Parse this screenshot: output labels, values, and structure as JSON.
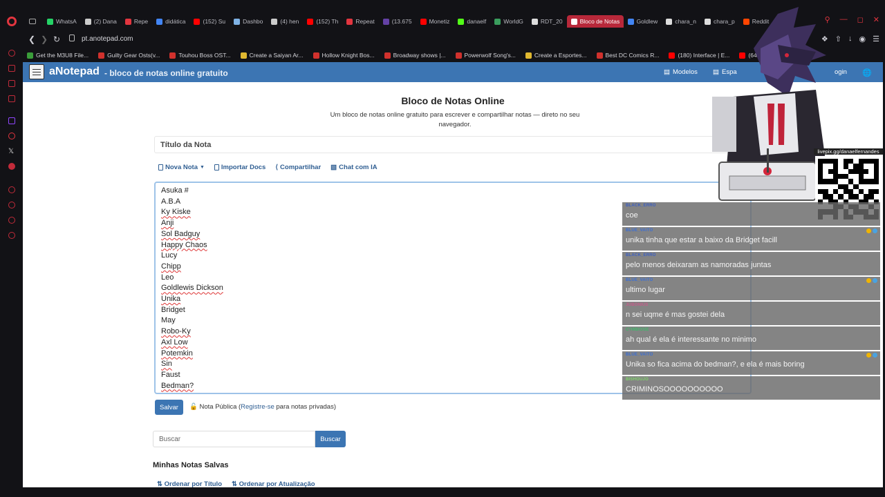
{
  "browser": {
    "tabs": [
      {
        "label": "WhatsA",
        "color": "#25d366"
      },
      {
        "label": "(2) Dana",
        "color": "#cccccc"
      },
      {
        "label": "Repe",
        "color": "#e2353f"
      },
      {
        "label": "didática",
        "color": "#4285f4"
      },
      {
        "label": "(152) Su",
        "color": "#ff0000"
      },
      {
        "label": "Dashbo",
        "color": "#7fb2e5"
      },
      {
        "label": "(4) hen",
        "color": "#cccccc"
      },
      {
        "label": "(152) Th",
        "color": "#ff0000"
      },
      {
        "label": "Repeat",
        "color": "#e2353f"
      },
      {
        "label": "(13.675",
        "color": "#6441a5"
      },
      {
        "label": "Monetiz",
        "color": "#ff0000"
      },
      {
        "label": "danaelf",
        "color": "#53fc18"
      },
      {
        "label": "WorldG",
        "color": "#3a9d5d"
      },
      {
        "label": "RDT_20",
        "color": "#dddddd"
      },
      {
        "label": "Bloco de Notas",
        "color": "#ffffff",
        "active": true
      },
      {
        "label": "Goldlew",
        "color": "#4285f4"
      },
      {
        "label": "chara_n",
        "color": "#dddddd"
      },
      {
        "label": "chara_p",
        "color": "#dddddd"
      },
      {
        "label": "Reddit",
        "color": "#ff4500"
      }
    ],
    "url": "pt.anotepad.com",
    "bookmarks": [
      {
        "label": "Get the M3U8 File...",
        "color": "#3a9d3a"
      },
      {
        "label": "Guilty Gear Osts(v...",
        "color": "#d0312d"
      },
      {
        "label": "Touhou Boss OST...",
        "color": "#d0312d"
      },
      {
        "label": "Create a Saiyan Ar...",
        "color": "#e0b830"
      },
      {
        "label": "Hollow Knight Bos...",
        "color": "#d0312d"
      },
      {
        "label": "Broadway shows |...",
        "color": "#d0312d"
      },
      {
        "label": "Powerwolf Song's...",
        "color": "#d0312d"
      },
      {
        "label": "Create a Esportes...",
        "color": "#e0b830"
      },
      {
        "label": "Best DC Comics R...",
        "color": "#d0312d"
      },
      {
        "label": "(180) Interface | E...",
        "color": "#ff0000"
      },
      {
        "label": "(647)",
        "color": "#ff0000"
      }
    ]
  },
  "site": {
    "brand": "aNotepad",
    "brand_sub": "- bloco de notas online gratuito",
    "nav_models": "Modelos",
    "nav_spaces": "Espa",
    "nav_login": "ogin"
  },
  "main": {
    "heading": "Bloco de Notas Online",
    "subheading": "Um bloco de notas online gratuito para escrever e compartilhar notas — direto no seu navegador.",
    "title_placeholder": "Título da Nota",
    "toolbar": {
      "new_note": "Nova Nota",
      "import_docs": "Importar Docs",
      "share": "Compartilhar",
      "chat_ai": "Chat com IA"
    },
    "note_lines": [
      "Asuka #",
      "A.B.A",
      "Ky Kiske",
      "Anji",
      "Sol Badguy",
      "Happy Chaos",
      "Lucy",
      "Chipp",
      "Leo",
      "Goldlewis Dickson",
      "Unika",
      "Bridget",
      "May",
      "Robo-Ky",
      "Axl Low",
      "Potemkin",
      "Sin",
      "Faust",
      "Bedman?"
    ],
    "save_label": "Salvar",
    "public_note_prefix": "Nota Pública (",
    "public_note_link": "Registre-se",
    "public_note_suffix": " para notas privadas)",
    "search_placeholder": "Buscar",
    "search_button": "Buscar",
    "saved_title": "Minhas Notas Salvas",
    "sort_by_title": "Ordenar por Título",
    "sort_by_update": "Ordenar por Atualização"
  },
  "overlay": {
    "qr_label": "livepix.gg/danaelfernandes",
    "chat": [
      {
        "user": "BLACK_ERRO",
        "user_color": "#3b5fc2",
        "text": "coe",
        "badge": false
      },
      {
        "user": "BLUE_VAITO",
        "user_color": "#3b6fd6",
        "text": "unika tinha que estar a baixo da Bridget facill",
        "badge": true
      },
      {
        "user": "BLACK_ERRO",
        "user_color": "#3b5fc2",
        "text": "pelo menos deixaram as namoradas juntas",
        "badge": false
      },
      {
        "user": "BLUE_VAITO",
        "user_color": "#3b6fd6",
        "text": "ultimo lugar",
        "badge": true
      },
      {
        "user": "JUBONIUS",
        "user_color": "#c75a8a",
        "text": "n sei uqme é mas gostei dela",
        "badge": false
      },
      {
        "user": "CYMBIOSE",
        "user_color": "#3fb86a",
        "text": "ah qual é ela é interessante no minimo",
        "badge": false
      },
      {
        "user": "BLUE_VAITO",
        "user_color": "#3b6fd6",
        "text": "Unika so fica acima do bedman?, e ela é mais boring",
        "badge": true
      },
      {
        "user": "BISHOUJO",
        "user_color": "#7fd66a",
        "text": "CRIMINOSOOOOOOOOOO",
        "badge": false
      }
    ]
  }
}
